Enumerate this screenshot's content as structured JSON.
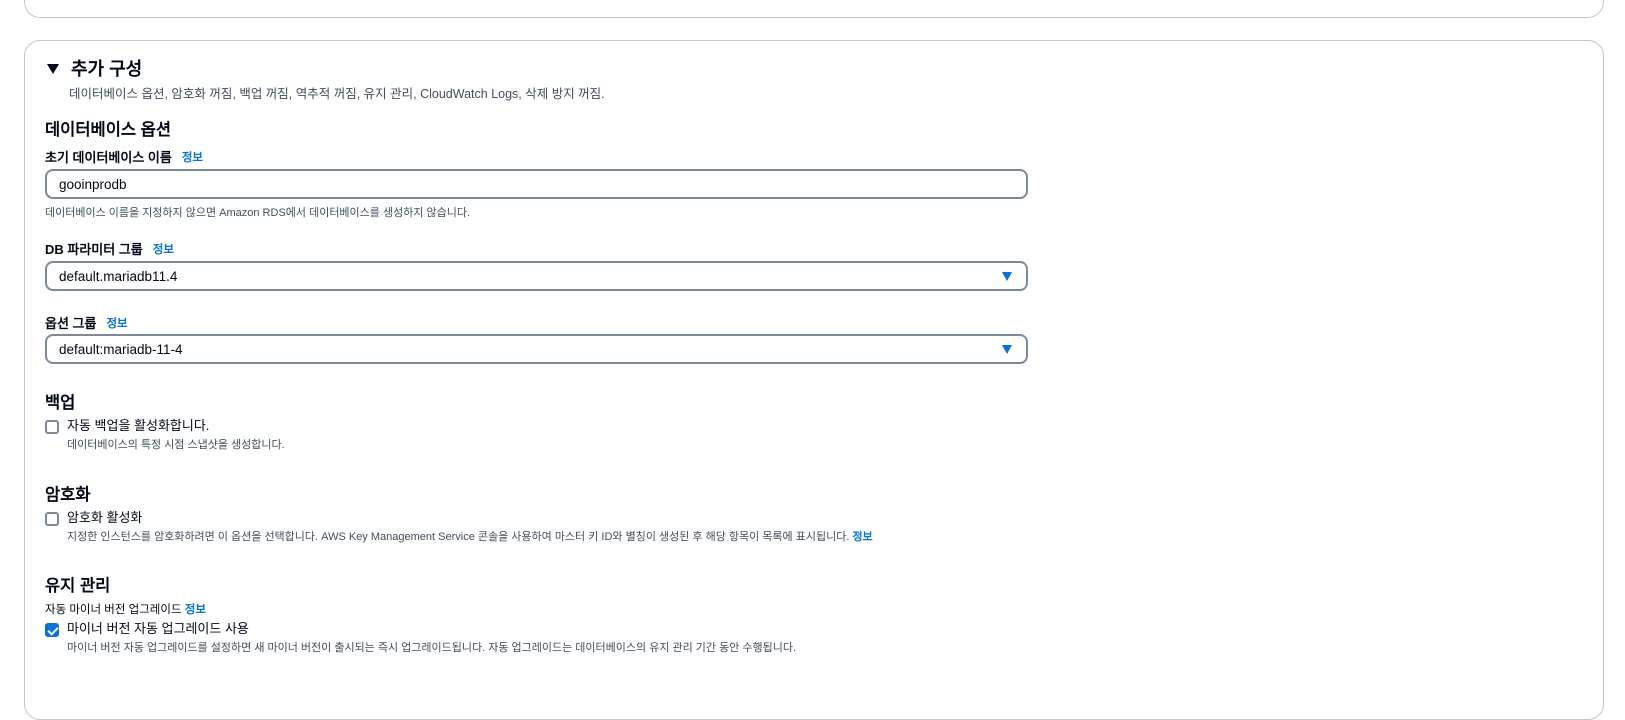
{
  "additional_config": {
    "title": "추가 구성",
    "description": "데이터베이스 옵션, 암호화 꺼짐, 백업 꺼짐, 역추적 꺼짐, 유지 관리, CloudWatch Logs, 삭제 방지 꺼짐."
  },
  "db_options": {
    "title": "데이터베이스 옵션",
    "initial_db_name": {
      "label": "초기 데이터베이스 이름",
      "info": "정보",
      "value": "gooinprodb",
      "hint": "데이터베이스 이름을 지정하지 않으면 Amazon RDS에서 데이터베이스를 생성하지 않습니다."
    },
    "param_group": {
      "label": "DB 파라미터 그룹",
      "info": "정보",
      "value": "default.mariadb11.4"
    },
    "option_group": {
      "label": "옵션 그룹",
      "info": "정보",
      "value": "default:mariadb-11-4"
    }
  },
  "backup": {
    "title": "백업",
    "auto_backup": {
      "label": "자동 백업을 활성화합니다.",
      "description": "데이터베이스의 특정 시점 스냅샷을 생성합니다.",
      "checked": false
    }
  },
  "encryption": {
    "title": "암호화",
    "enable": {
      "label": "암호화 활성화",
      "description": "지정한 인스턴스를 암호화하려면 이 옵션을 선택합니다. AWS Key Management Service 콘솔을 사용하여 마스터 키 ID와 별칭이 생성된 후 해당 항목이 목록에 표시됩니다.",
      "info": "정보",
      "checked": false
    }
  },
  "maintenance": {
    "title": "유지 관리",
    "auto_minor_label": "자동 마이너 버전 업그레이드",
    "info": "정보",
    "auto_minor": {
      "label": "마이너 버전 자동 업그레이드 사용",
      "description": "마이너 버전 자동 업그레이드를 설정하면 새 마이너 버전이 출시되는 즉시 업그레이드됩니다. 자동 업그레이드는 데이터베이스의 유지 관리 기간 동안 수행됩니다.",
      "checked": true
    }
  },
  "colors": {
    "link": "#0972d3",
    "text": "#000716",
    "muted": "#414d5c",
    "border": "#7d8998"
  }
}
